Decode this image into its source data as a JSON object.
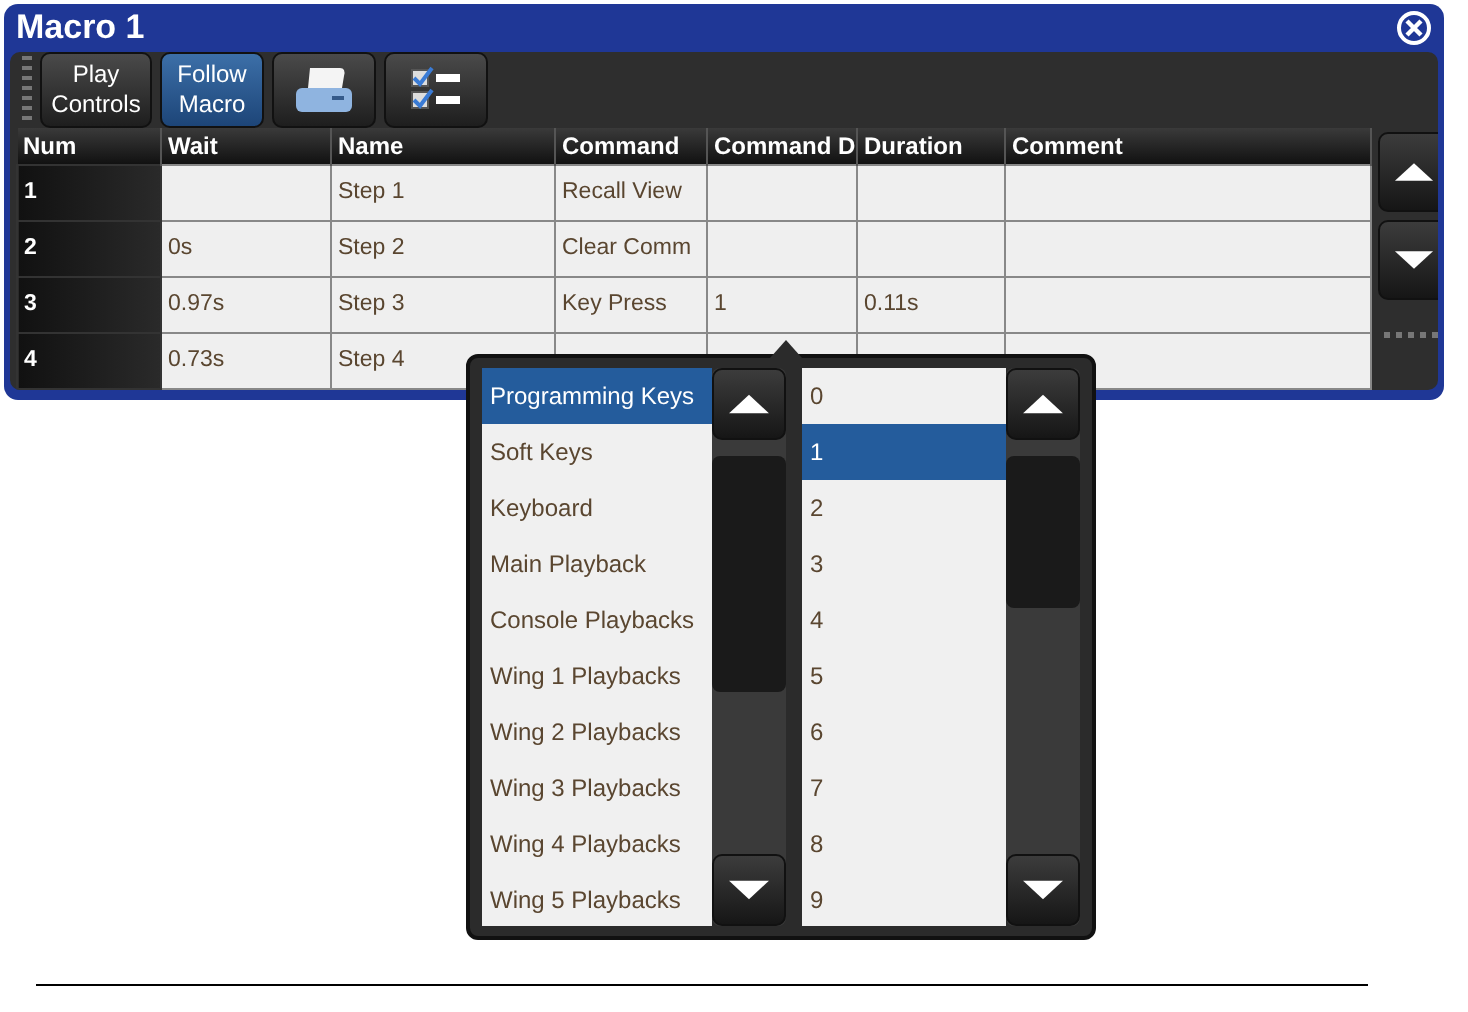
{
  "window": {
    "title": "Macro 1"
  },
  "toolbar": [
    {
      "kind": "text",
      "label": "Play Controls",
      "selected": false
    },
    {
      "kind": "text",
      "label": "Follow Macro",
      "selected": true
    },
    {
      "kind": "printer",
      "selected": false
    },
    {
      "kind": "checklist",
      "selected": false
    }
  ],
  "table": {
    "columns": [
      "Num",
      "Wait",
      "Name",
      "Command",
      "Command D",
      "Duration",
      "Comment"
    ],
    "rows": [
      {
        "cells": [
          "1",
          null,
          "Step 1",
          "Recall View",
          null,
          null,
          null
        ]
      },
      {
        "cells": [
          "2",
          "0s",
          "Step 2",
          "Clear Comm",
          null,
          null,
          null
        ]
      },
      {
        "cells": [
          "3",
          "0.97s",
          "Step 3",
          "Key Press",
          "1",
          "0.11s",
          null
        ]
      },
      {
        "cells": [
          "4",
          "0.73s",
          "Step 4",
          null,
          null,
          null,
          null
        ]
      }
    ]
  },
  "popup": {
    "lists": [
      {
        "items": [
          {
            "label": "Programming Keys",
            "selected": true
          },
          {
            "label": "Soft Keys",
            "selected": false
          },
          {
            "label": "Keyboard",
            "selected": false
          },
          {
            "label": "Main Playback",
            "selected": false
          },
          {
            "label": "Console Playbacks",
            "selected": false
          },
          {
            "label": "Wing 1 Playbacks",
            "selected": false
          },
          {
            "label": "Wing 2 Playbacks",
            "selected": false
          },
          {
            "label": "Wing 3 Playbacks",
            "selected": false
          },
          {
            "label": "Wing 4 Playbacks",
            "selected": false
          },
          {
            "label": "Wing 5 Playbacks",
            "selected": false
          }
        ]
      },
      {
        "items": [
          {
            "label": "0",
            "selected": false
          },
          {
            "label": "1",
            "selected": true
          },
          {
            "label": "2",
            "selected": false
          },
          {
            "label": "3",
            "selected": false
          },
          {
            "label": "4",
            "selected": false
          },
          {
            "label": "5",
            "selected": false
          },
          {
            "label": "6",
            "selected": false
          },
          {
            "label": "7",
            "selected": false
          },
          {
            "label": "8",
            "selected": false
          },
          {
            "label": "9",
            "selected": false
          }
        ]
      }
    ]
  }
}
